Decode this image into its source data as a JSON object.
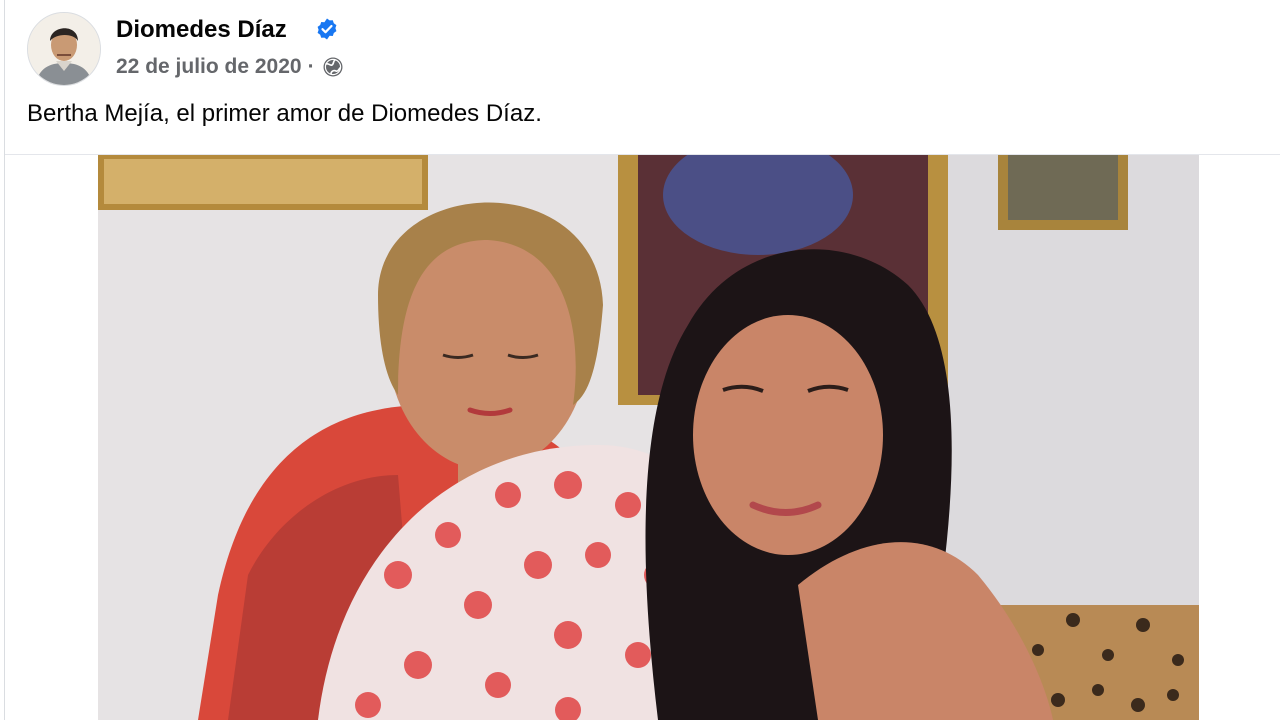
{
  "post": {
    "author": "Diomedes Díaz",
    "date": "22 de julio de 2020",
    "separator": "·",
    "caption": "Bertha Mejía, el primer amor de Diomedes Díaz.",
    "icons": {
      "verified": "verified-badge-icon",
      "audience": "globe-icon"
    }
  },
  "colors": {
    "verified_blue": "#1877f2",
    "meta_gray": "#65676b",
    "text": "#050505"
  }
}
